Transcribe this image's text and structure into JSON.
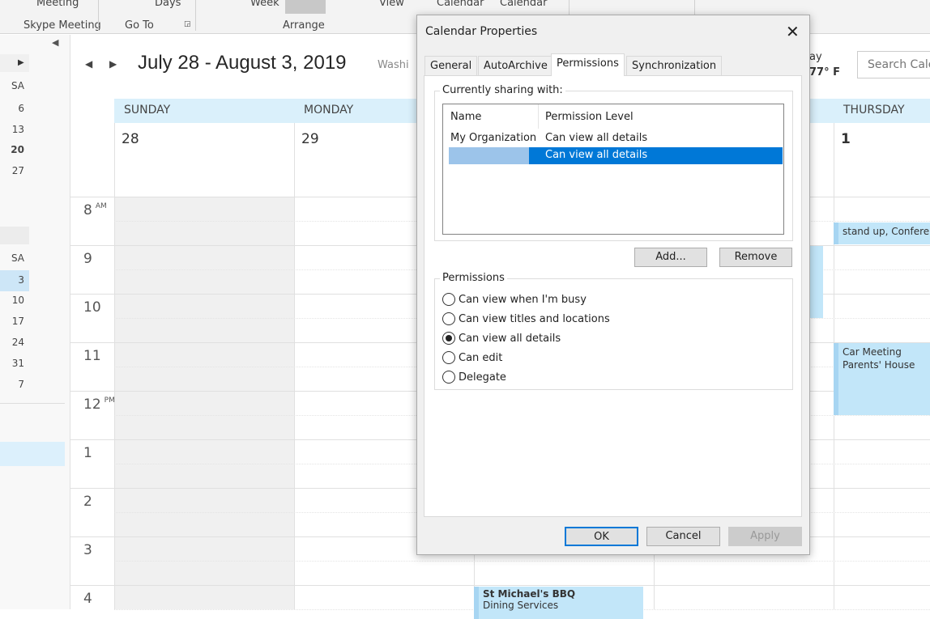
{
  "ribbon": {
    "meeting": "Meeting",
    "skype_meeting": "Skype Meeting",
    "days": "Days",
    "go_to": "Go To",
    "week": "Week",
    "arrange": "Arrange",
    "view": "View",
    "calendar1": "Calendar ˅",
    "calendar2": "Calendar ˅"
  },
  "mini_calendar": {
    "header": "SA",
    "month1": [
      "6",
      "13",
      "20",
      "27"
    ],
    "month2": [
      "3",
      "10",
      "17",
      "24",
      "31",
      "7"
    ]
  },
  "calendar": {
    "title": "July 28 - August 3, 2019",
    "location": "Washi",
    "weather_day": "ay",
    "weather_temp": "77° F",
    "search_placeholder": "Search Cale",
    "days": [
      {
        "name": "SUNDAY",
        "num": "28"
      },
      {
        "name": "MONDAY",
        "num": "29"
      },
      {
        "name": "THURSDAY",
        "num": "1"
      }
    ],
    "hours": [
      {
        "h": "8",
        "ap": "AM"
      },
      {
        "h": "9",
        "ap": ""
      },
      {
        "h": "10",
        "ap": ""
      },
      {
        "h": "11",
        "ap": ""
      },
      {
        "h": "12",
        "ap": "PM"
      },
      {
        "h": "1",
        "ap": ""
      },
      {
        "h": "2",
        "ap": ""
      },
      {
        "h": "3",
        "ap": ""
      },
      {
        "h": "4",
        "ap": ""
      }
    ],
    "events": {
      "standup": "stand up, Confere",
      "car_title": "Car Meeting",
      "car_loc": "Parents' House",
      "bbq_title": "St Michael's BBQ",
      "bbq_loc": "Dining Services"
    }
  },
  "dialog": {
    "title": "Calendar Properties",
    "tabs": [
      "General",
      "AutoArchive",
      "Permissions",
      "Synchronization"
    ],
    "active_tab": "Permissions",
    "sharing_label": "Currently sharing with:",
    "columns": [
      "Name",
      "Permission Level"
    ],
    "rows": [
      {
        "name": "My Organization",
        "level": "Can view all details",
        "selected": false
      },
      {
        "name": "",
        "level": "Can view all details",
        "selected": true
      }
    ],
    "add": "Add...",
    "remove": "Remove",
    "permissions_label": "Permissions",
    "options": [
      "Can view when I'm busy",
      "Can view titles and locations",
      "Can view all details",
      "Can edit",
      "Delegate"
    ],
    "selected_option": "Can view all details",
    "ok": "OK",
    "cancel": "Cancel",
    "apply": "Apply"
  }
}
